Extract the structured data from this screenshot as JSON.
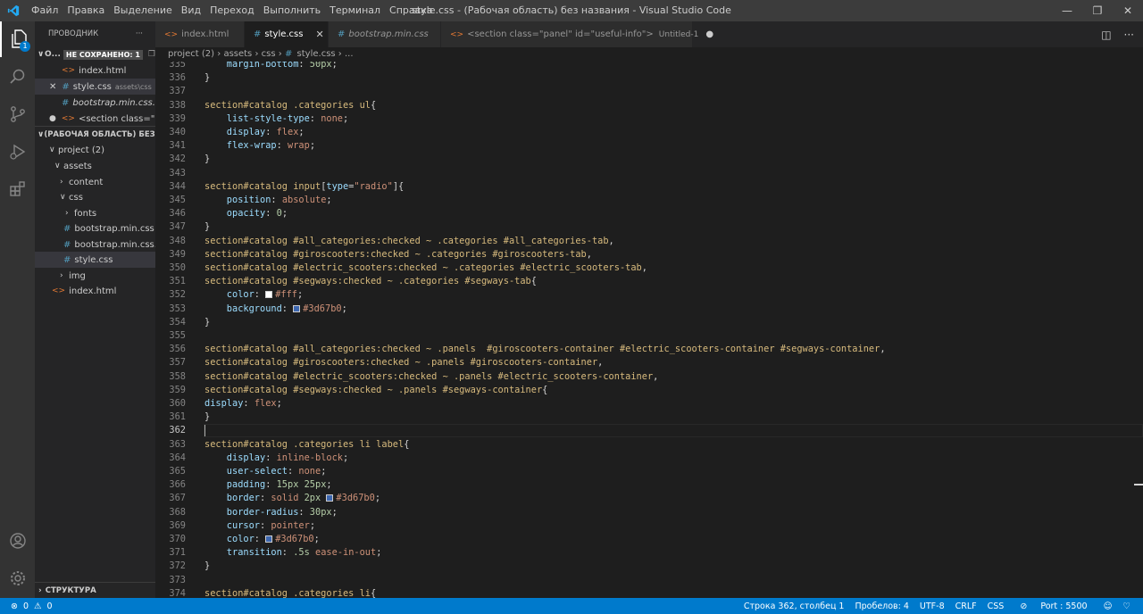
{
  "titlebar": {
    "menu": [
      "Файл",
      "Правка",
      "Выделение",
      "Вид",
      "Переход",
      "Выполнить",
      "Терминал",
      "Справка"
    ],
    "title": "style.css - (Рабочая область) без названия - Visual Studio Code"
  },
  "sidebar": {
    "header": "ПРОВОДНИК",
    "more": "···",
    "open_editors_label": "О...",
    "unsaved_label": "НЕ СОХРАНЕНО: 1",
    "open_editors": [
      {
        "name": "index.html",
        "type": "html",
        "dim": ""
      },
      {
        "name": "style.css",
        "type": "css",
        "dim": "assets\\css"
      },
      {
        "name": "bootstrap.min.css...",
        "type": "css",
        "dim": ""
      },
      {
        "name": "<section class=\"p...",
        "type": "html",
        "dim": ""
      }
    ],
    "workspace_label": "(РАБОЧАЯ ОБЛАСТЬ) БЕЗ ...",
    "tree": {
      "project": "project (2)",
      "assets": "assets",
      "content": "content",
      "css": "css",
      "fonts": "fonts",
      "bootstrap1": "bootstrap.min.css",
      "bootstrap2": "bootstrap.min.css...",
      "style": "style.css",
      "img": "img",
      "index": "index.html"
    },
    "structure": "СТРУКТУРА"
  },
  "tabs": [
    {
      "label": "index.html",
      "type": "html"
    },
    {
      "label": "style.css",
      "type": "css",
      "active": true
    },
    {
      "label": "bootstrap.min.css",
      "type": "css",
      "italic": true
    },
    {
      "label": "<section class=\"panel\" id=\"useful-info\">",
      "extra": "Untitled-1",
      "type": "html"
    }
  ],
  "breadcrumb": {
    "parts": [
      "project (2)",
      "assets",
      "css",
      "style.css",
      "..."
    ]
  },
  "editor": {
    "lines": [
      {
        "n": "335",
        "code": [
          [
            "t-prop",
            "    margin-bottom"
          ],
          [
            "t-p",
            ": "
          ],
          [
            "t-num",
            "50px"
          ],
          [
            "t-p",
            ";"
          ]
        ]
      },
      {
        "n": "336",
        "code": [
          [
            "t-p",
            "}"
          ]
        ]
      },
      {
        "n": "337",
        "code": []
      },
      {
        "n": "338",
        "code": [
          [
            "t-sel",
            "section#catalog .categories ul"
          ],
          [
            "t-p",
            "{"
          ]
        ]
      },
      {
        "n": "339",
        "code": [
          [
            "t-prop",
            "    list-style-type"
          ],
          [
            "t-p",
            ": "
          ],
          [
            "t-val",
            "none"
          ],
          [
            "t-p",
            ";"
          ]
        ]
      },
      {
        "n": "340",
        "code": [
          [
            "t-prop",
            "    display"
          ],
          [
            "t-p",
            ": "
          ],
          [
            "t-val",
            "flex"
          ],
          [
            "t-p",
            ";"
          ]
        ]
      },
      {
        "n": "341",
        "code": [
          [
            "t-prop",
            "    flex-wrap"
          ],
          [
            "t-p",
            ": "
          ],
          [
            "t-val",
            "wrap"
          ],
          [
            "t-p",
            ";"
          ]
        ]
      },
      {
        "n": "342",
        "code": [
          [
            "t-p",
            "}"
          ]
        ]
      },
      {
        "n": "343",
        "code": []
      },
      {
        "n": "344",
        "code": [
          [
            "t-sel",
            "section#catalog input"
          ],
          [
            "t-p",
            "["
          ],
          [
            "t-prop",
            "type"
          ],
          [
            "t-p",
            "="
          ],
          [
            "t-str",
            "\"radio\""
          ],
          [
            "t-p",
            "]{"
          ]
        ]
      },
      {
        "n": "345",
        "code": [
          [
            "t-prop",
            "    position"
          ],
          [
            "t-p",
            ": "
          ],
          [
            "t-val",
            "absolute"
          ],
          [
            "t-p",
            ";"
          ]
        ]
      },
      {
        "n": "346",
        "code": [
          [
            "t-prop",
            "    opacity"
          ],
          [
            "t-p",
            ": "
          ],
          [
            "t-num",
            "0"
          ],
          [
            "t-p",
            ";"
          ]
        ]
      },
      {
        "n": "347",
        "code": [
          [
            "t-p",
            "}"
          ]
        ]
      },
      {
        "n": "348",
        "code": [
          [
            "t-sel",
            "section#catalog #all_categories:checked ~ .categories #all_categories-tab"
          ],
          [
            "t-p",
            ","
          ]
        ]
      },
      {
        "n": "349",
        "code": [
          [
            "t-sel",
            "section#catalog #giroscooters:checked ~ .categories #giroscooters-tab"
          ],
          [
            "t-p",
            ","
          ]
        ]
      },
      {
        "n": "350",
        "code": [
          [
            "t-sel",
            "section#catalog #electric_scooters:checked ~ .categories #electric_scooters-tab"
          ],
          [
            "t-p",
            ","
          ]
        ]
      },
      {
        "n": "351",
        "code": [
          [
            "t-sel",
            "section#catalog #segways:checked ~ .categories #segways-tab"
          ],
          [
            "t-p",
            "{"
          ]
        ]
      },
      {
        "n": "352",
        "code": [
          [
            "t-prop",
            "    color"
          ],
          [
            "t-p",
            ": "
          ],
          [
            "sw:#ffffff",
            ""
          ],
          [
            "t-val",
            "#fff"
          ],
          [
            "t-p",
            ";"
          ]
        ]
      },
      {
        "n": "353",
        "code": [
          [
            "t-prop",
            "    background"
          ],
          [
            "t-p",
            ": "
          ],
          [
            "sw:#3d67b0",
            ""
          ],
          [
            "t-val",
            "#3d67b0"
          ],
          [
            "t-p",
            ";"
          ]
        ]
      },
      {
        "n": "354",
        "code": [
          [
            "t-p",
            "}"
          ]
        ]
      },
      {
        "n": "355",
        "code": []
      },
      {
        "n": "356",
        "code": [
          [
            "t-sel",
            "section#catalog #all_categories:checked ~ .panels  #giroscooters-container #electric_scooters-container #segways-container"
          ],
          [
            "t-p",
            ","
          ]
        ]
      },
      {
        "n": "357",
        "code": [
          [
            "t-sel",
            "section#catalog #giroscooters:checked ~ .panels #giroscooters-container"
          ],
          [
            "t-p",
            ","
          ]
        ]
      },
      {
        "n": "358",
        "code": [
          [
            "t-sel",
            "section#catalog #electric_scooters:checked ~ .panels #electric_scooters-container"
          ],
          [
            "t-p",
            ","
          ]
        ]
      },
      {
        "n": "359",
        "code": [
          [
            "t-sel",
            "section#catalog #segways:checked ~ .panels #segways-container"
          ],
          [
            "t-p",
            "{"
          ]
        ]
      },
      {
        "n": "360",
        "code": [
          [
            "t-prop",
            "display"
          ],
          [
            "t-p",
            ": "
          ],
          [
            "t-val",
            "flex"
          ],
          [
            "t-p",
            ";"
          ]
        ]
      },
      {
        "n": "361",
        "code": [
          [
            "t-p",
            "}"
          ]
        ]
      },
      {
        "n": "362",
        "code": [],
        "current": true
      },
      {
        "n": "363",
        "code": [
          [
            "t-sel",
            "section#catalog .categories li label"
          ],
          [
            "t-p",
            "{"
          ]
        ]
      },
      {
        "n": "364",
        "code": [
          [
            "t-prop",
            "    display"
          ],
          [
            "t-p",
            ": "
          ],
          [
            "t-val",
            "inline-block"
          ],
          [
            "t-p",
            ";"
          ]
        ]
      },
      {
        "n": "365",
        "code": [
          [
            "t-prop",
            "    user-select"
          ],
          [
            "t-p",
            ": "
          ],
          [
            "t-val",
            "none"
          ],
          [
            "t-p",
            ";"
          ]
        ]
      },
      {
        "n": "366",
        "code": [
          [
            "t-prop",
            "    padding"
          ],
          [
            "t-p",
            ": "
          ],
          [
            "t-num",
            "15px 25px"
          ],
          [
            "t-p",
            ";"
          ]
        ]
      },
      {
        "n": "367",
        "code": [
          [
            "t-prop",
            "    border"
          ],
          [
            "t-p",
            ": "
          ],
          [
            "t-val",
            "solid "
          ],
          [
            "t-num",
            "2px "
          ],
          [
            "sw:#3d67b0",
            ""
          ],
          [
            "t-val",
            "#3d67b0"
          ],
          [
            "t-p",
            ";"
          ]
        ]
      },
      {
        "n": "368",
        "code": [
          [
            "t-prop",
            "    border-radius"
          ],
          [
            "t-p",
            ": "
          ],
          [
            "t-num",
            "30px"
          ],
          [
            "t-p",
            ";"
          ]
        ]
      },
      {
        "n": "369",
        "code": [
          [
            "t-prop",
            "    cursor"
          ],
          [
            "t-p",
            ": "
          ],
          [
            "t-val",
            "pointer"
          ],
          [
            "t-p",
            ";"
          ]
        ]
      },
      {
        "n": "370",
        "code": [
          [
            "t-prop",
            "    color"
          ],
          [
            "t-p",
            ": "
          ],
          [
            "sw:#3d67b0",
            ""
          ],
          [
            "t-val",
            "#3d67b0"
          ],
          [
            "t-p",
            ";"
          ]
        ]
      },
      {
        "n": "371",
        "code": [
          [
            "t-prop",
            "    transition"
          ],
          [
            "t-p",
            ": "
          ],
          [
            "t-num",
            ".5s "
          ],
          [
            "t-val",
            "ease-in-out"
          ],
          [
            "t-p",
            ";"
          ]
        ]
      },
      {
        "n": "372",
        "code": [
          [
            "t-p",
            "}"
          ]
        ]
      },
      {
        "n": "373",
        "code": []
      },
      {
        "n": "374",
        "code": [
          [
            "t-sel",
            "section#catalog .categories li"
          ],
          [
            "t-p",
            "{"
          ]
        ]
      }
    ]
  },
  "statusbar": {
    "errors": "0",
    "warnings": "0",
    "position": "Строка 362, столбец 1",
    "spaces": "Пробелов: 4",
    "encoding": "UTF-8",
    "eol": "CRLF",
    "language": "CSS",
    "port": "Port : 5500"
  },
  "colors": {
    "accent": "#007acc",
    "swatch_white": "#ffffff",
    "swatch_blue": "#3d67b0"
  }
}
